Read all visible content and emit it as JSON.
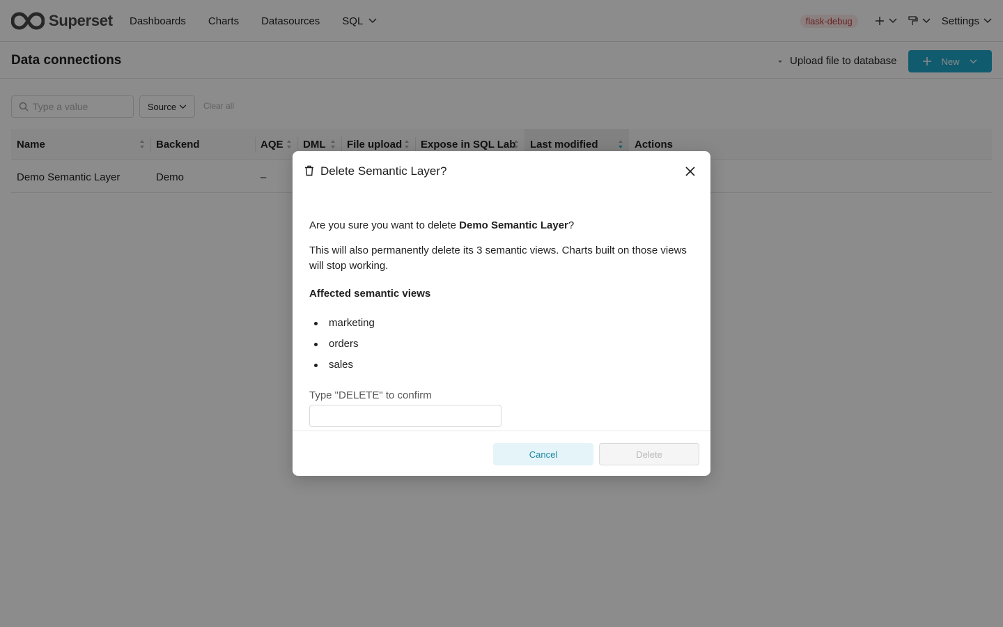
{
  "app": {
    "name": "Superset"
  },
  "nav": {
    "items": [
      {
        "label": "Dashboards"
      },
      {
        "label": "Charts"
      },
      {
        "label": "Datasources"
      },
      {
        "label": "SQL"
      }
    ],
    "env_badge": "flask-debug",
    "settings_label": "Settings"
  },
  "subheader": {
    "title": "Data connections",
    "upload_label": "Upload file to database",
    "new_label": "New"
  },
  "filters": {
    "search_placeholder": "Type a value",
    "source_label": "Source",
    "clear_all": "Clear all"
  },
  "table": {
    "columns": [
      {
        "label": "Name"
      },
      {
        "label": "Backend"
      },
      {
        "label": "AQE"
      },
      {
        "label": "DML"
      },
      {
        "label": "File upload"
      },
      {
        "label": "Expose in SQL Lab"
      },
      {
        "label": "Last modified"
      },
      {
        "label": "Actions"
      }
    ],
    "rows": [
      {
        "name": "Demo Semantic Layer",
        "backend": "Demo",
        "aqe": "–"
      }
    ]
  },
  "modal": {
    "title": "Delete Semantic Layer?",
    "question_prefix": "Are you sure you want to delete ",
    "question_target": "Demo Semantic Layer",
    "question_suffix": "?",
    "warning": "This will also permanently delete its 3 semantic views. Charts built on those views will stop working.",
    "section_label": "Affected semantic views",
    "views": [
      "marketing",
      "orders",
      "sales"
    ],
    "confirm_label": "Type \"DELETE\" to confirm",
    "confirm_value": "",
    "cancel_label": "Cancel",
    "delete_label": "Delete"
  },
  "colors": {
    "primary": "#20a7c9",
    "badge_bg": "#fce9e9",
    "badge_text": "#c13d3d",
    "cancel_bg": "#e4f4f8",
    "cancel_text": "#1a85a0"
  }
}
